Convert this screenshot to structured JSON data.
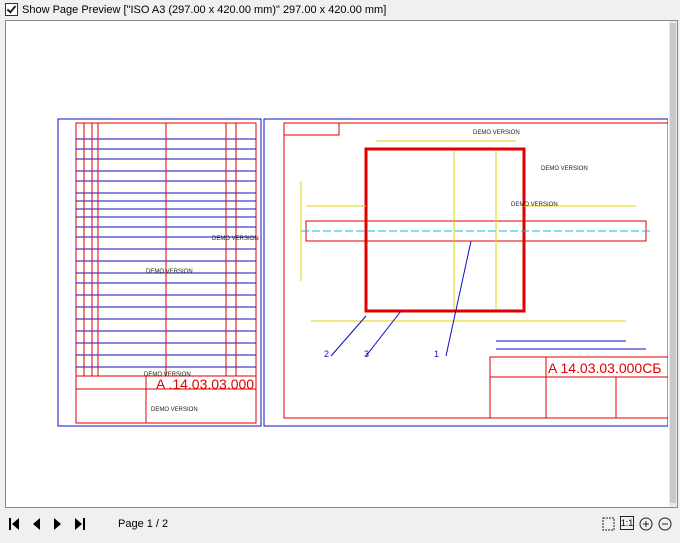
{
  "header": {
    "checkbox_label": "Show Page Preview [\"ISO A3 (297.00 x 420.00 mm)\" 297.00 x 420.00 mm]",
    "checked": true
  },
  "drawing": {
    "watermark": "DEMO VERSION",
    "left_stamp": "A .14.03.03.000",
    "right_stamp": "A  14.03.03.000СБ",
    "callouts": [
      "1",
      "2",
      "3"
    ],
    "colors": {
      "frame": "#1010c0",
      "red": "#e00000",
      "yellow": "#e0d000",
      "cyan": "#00c0e0"
    }
  },
  "footer": {
    "page_label": "Page 1 / 2",
    "nav": [
      "first-page",
      "prev-page",
      "next-page",
      "last-page"
    ],
    "tools": [
      "fit-page",
      "actual-size",
      "zoom-in",
      "zoom-out"
    ]
  }
}
